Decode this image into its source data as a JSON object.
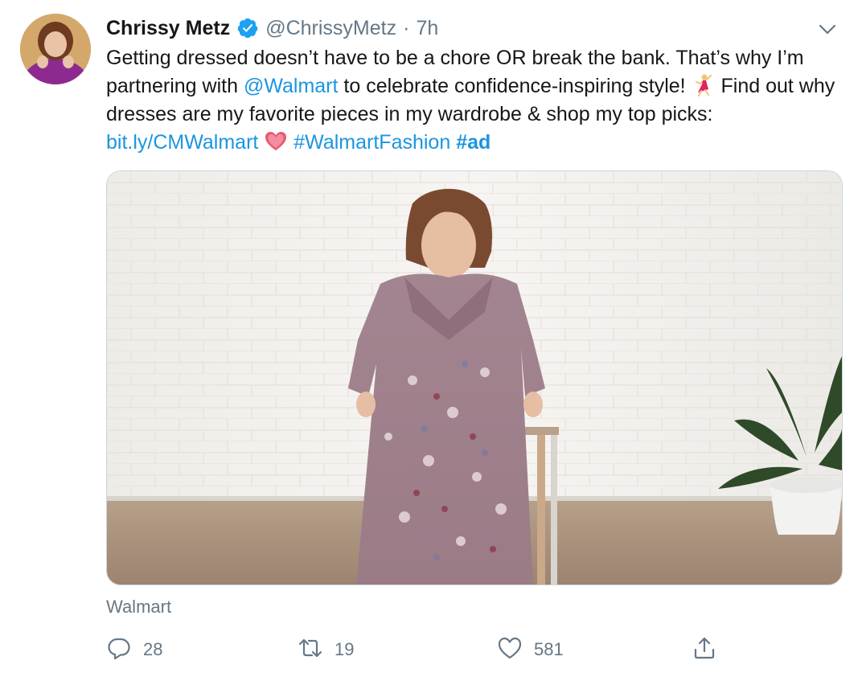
{
  "author": {
    "name": "Chrissy Metz",
    "handle": "@ChrissyMetz",
    "separator": "·",
    "time": "7h"
  },
  "tweet": {
    "text_part1": "Getting dressed doesn’t have to be a chore OR break the bank. That’s why I’m partnering with ",
    "mention": "@Walmart",
    "text_part2": " to celebrate confidence-inspiring style! ",
    "text_part3": " Find out why dresses are my favorite pieces in my wardrobe & shop my top picks: ",
    "link": "bit.ly/CMWalmart",
    "hashtag1": "#WalmartFashion",
    "hashtag2": "#ad"
  },
  "icons": {
    "verified": "verified-badge-icon",
    "more": "chevron-down-icon",
    "emoji_dancer": "dancing-woman-emoji",
    "emoji_heart": "heart-emoji",
    "reply": "reply-icon",
    "retweet": "retweet-icon",
    "like": "like-heart-icon",
    "share": "share-icon"
  },
  "media": {
    "source": "Walmart"
  },
  "actions": {
    "reply_count": "28",
    "retweet_count": "19",
    "like_count": "581"
  },
  "colors": {
    "link": "#1b95e0",
    "secondary": "#657786",
    "verified": "#1da1f2"
  }
}
